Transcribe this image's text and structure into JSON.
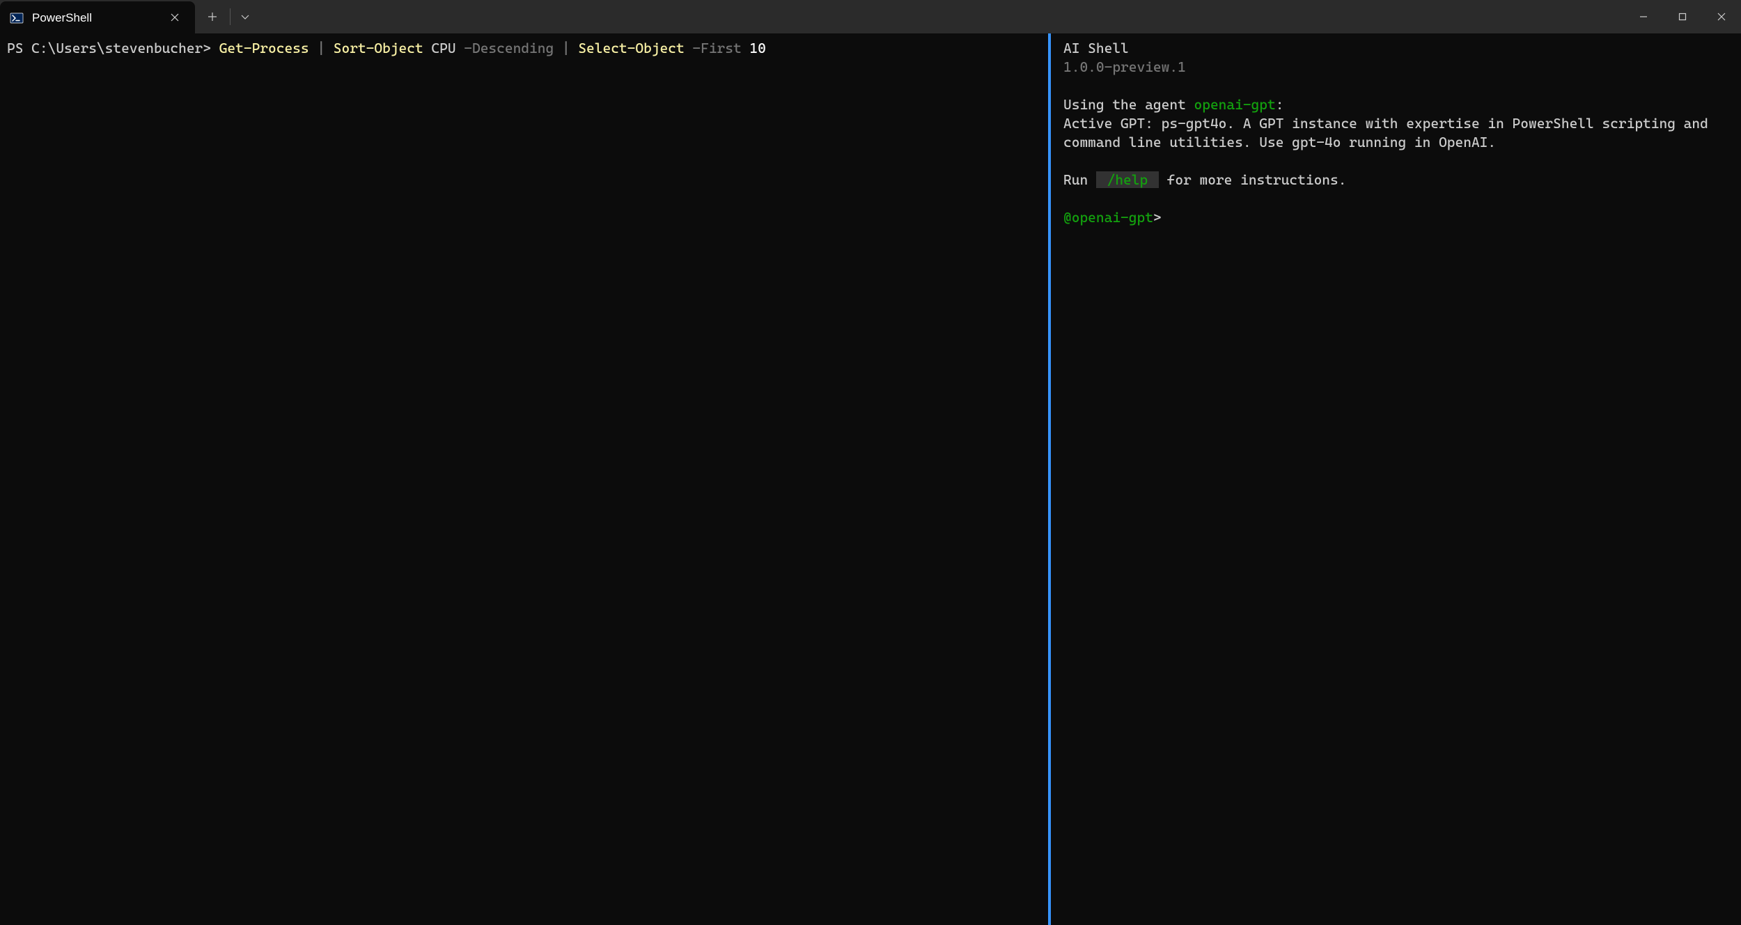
{
  "titlebar": {
    "tab": {
      "title": "PowerShell"
    }
  },
  "leftPane": {
    "prompt": "PS C:\\Users\\stevenbucher>",
    "command": {
      "cmdlet1": "Get-Process",
      "pipe1": "|",
      "cmdlet2": "Sort-Object",
      "arg1": "CPU",
      "param1": "-Descending",
      "pipe2": "|",
      "cmdlet3": "Select-Object",
      "param2": "-First",
      "number": "10"
    }
  },
  "rightPane": {
    "title": "AI Shell",
    "version": "1.0.0-preview.1",
    "usingText": "Using the agent ",
    "agentName": "openai-gpt",
    "colon": ":",
    "activeGptText": "Active GPT: ps-gpt4o. A GPT instance with expertise in PowerShell scripting and command line utilities. Use gpt-4o running in OpenAI.",
    "runText": "Run ",
    "helpCmd": " /help ",
    "runSuffix": " for more instructions.",
    "promptAgent": "@openai-gpt",
    "promptSuffix": ">"
  }
}
